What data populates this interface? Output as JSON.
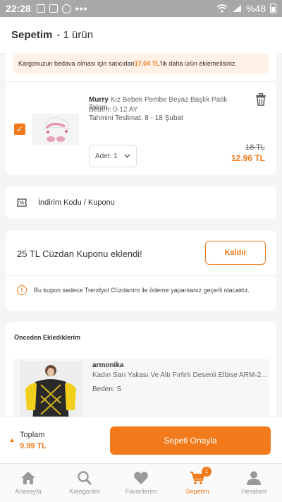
{
  "status_bar": {
    "time": "22:28",
    "battery_text": "%48"
  },
  "header": {
    "title": "Sepetim",
    "count": "- 1 ürün"
  },
  "cart": {
    "cargo_notice_prefix": "Kargonuzun bedava olması için satıcıdan ",
    "cargo_notice_amount": "17.04 TL",
    "cargo_notice_suffix": "'lik daha ürün eklemelisiniz.",
    "product": {
      "brand": "Murry",
      "name": "Kız Bebek Pembe Beyaz Başlık Patik Takım",
      "size": "Beden: 0-12 AY",
      "delivery": "Tahmini Teslimat: 8 - 18 Şubat",
      "quantity": "Adet: 1",
      "old_price": "18 TL",
      "new_price": "12.96 TL",
      "selected": true
    }
  },
  "discount": {
    "label": "İndirim Kodu / Kuponu"
  },
  "wallet": {
    "message": "25 TL Cüzdan Kuponu eklendi!",
    "remove_label": "Kaldır",
    "info": "Bu kupon sadece Trendyol Cüzdanım ile ödeme yaparsanız geçerli olacaktır."
  },
  "previous": {
    "title": "Önceden Eklediklerim",
    "item": {
      "brand": "armonika",
      "name": "Kadın Sarı Yakası Ve Altı Fırfırlı Desenli Elbise ARM-2...",
      "size": "Beden: S"
    }
  },
  "checkout": {
    "total_label": "Toplam",
    "total_value": "9.99 TL",
    "confirm_label": "Sepeti Onayla"
  },
  "bottom_nav": {
    "items": [
      {
        "label": "Anasayfa",
        "icon": "home-icon"
      },
      {
        "label": "Kategoriler",
        "icon": "search-icon"
      },
      {
        "label": "Favorilerim",
        "icon": "heart-icon"
      },
      {
        "label": "Sepetim",
        "icon": "cart-icon",
        "badge": "1"
      },
      {
        "label": "Hesabım",
        "icon": "user-icon"
      }
    ]
  },
  "colors": {
    "accent": "#f27a1a",
    "banner_bg": "#fff1e6"
  }
}
